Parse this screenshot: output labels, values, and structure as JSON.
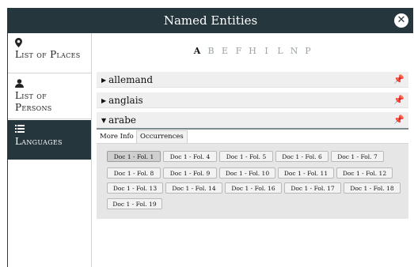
{
  "window": {
    "title": "Named Entities",
    "close_icon": "close-icon"
  },
  "sidebar": {
    "items": [
      {
        "icon": "map-pin-icon",
        "label": "List of Places",
        "active": false
      },
      {
        "icon": "user-icon",
        "label": "List of Persons",
        "active": false
      },
      {
        "icon": "list-icon",
        "label": "Languages",
        "active": true
      }
    ]
  },
  "alphabet": {
    "letters": [
      "A",
      "B",
      "E",
      "F",
      "H",
      "I",
      "L",
      "N",
      "P"
    ],
    "current": "A"
  },
  "entries": [
    {
      "label": "allemand",
      "expanded": false,
      "pin_icon": "pin-icon"
    },
    {
      "label": "anglais",
      "expanded": false,
      "pin_icon": "pin-icon"
    },
    {
      "label": "arabe",
      "expanded": true,
      "pin_icon": "pin-icon"
    }
  ],
  "detail_tabs": [
    "More Info",
    "Occurrences"
  ],
  "selected_tab": "Occurrences",
  "occurrences": [
    "Doc 1 - Fol. 1",
    "Doc 1 - Fol. 4",
    "Doc 1 - Fol. 5",
    "Doc 1 - Fol. 6",
    "Doc 1 - Fol. 7",
    "Doc 1 - Fol. 8",
    "Doc 1 - Fol. 9",
    "Doc 1 - Fol. 10",
    "Doc 1 - Fol. 11",
    "Doc 1 - Fol. 12",
    "Doc 1 - Fol. 13",
    "Doc 1 - Fol. 14",
    "Doc 1 - Fol. 16",
    "Doc 1 - Fol. 17",
    "Doc 1 - Fol. 18",
    "Doc 1 - Fol. 19"
  ],
  "selected_occurrence": "Doc 1 - Fol. 1"
}
